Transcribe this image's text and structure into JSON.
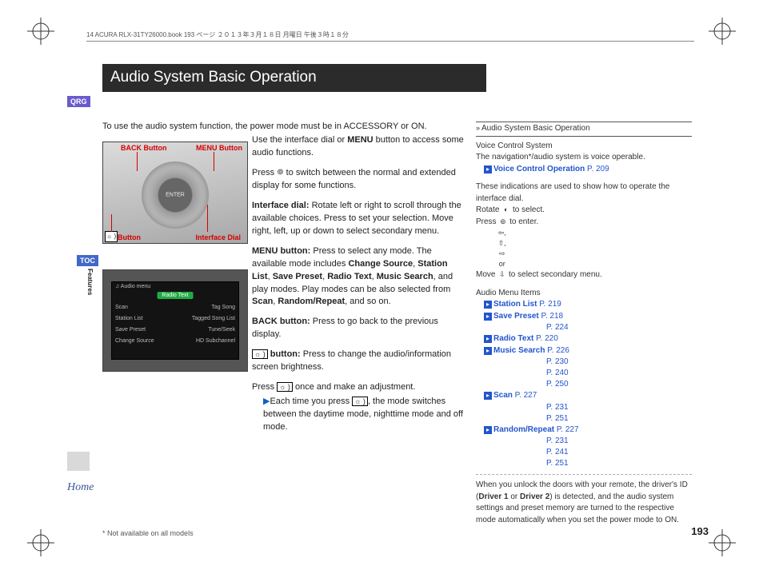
{
  "book_info": "14 ACURA RLX-31TY26000.book  193 ページ  ２０１３年３月１８日  月曜日  午後３時１８分",
  "title": "Audio System Basic Operation",
  "tabs": {
    "qrg": "QRG",
    "toc": "TOC",
    "features": "Features",
    "home": "Home"
  },
  "intro": "To use the audio system function, the power mode must be in ACCESSORY or ON.",
  "photo1_labels": {
    "back": "BACK Button",
    "menu": "MENU Button",
    "bright": "Button",
    "dial": "Interface Dial",
    "bright_icon": "☼ )",
    "enter": "ENTER"
  },
  "photo2": {
    "title": "♫ Audio menu",
    "center": "Radio Text",
    "rows_left": [
      "Scan",
      "Station List",
      "Save Preset",
      "Change Source"
    ],
    "rows_right": [
      "Tag Song",
      "Tagged Song List",
      "Tune/Seek",
      "HD Subchannel"
    ]
  },
  "main": {
    "p1a": "Use the interface dial or ",
    "p1b": "MENU",
    "p1c": " button to access some audio functions.",
    "p2a": "Press ",
    "p2_icon": "⊚",
    "p2b": " to switch between the normal and extended display for some functions.",
    "p3a": "Interface dial:",
    "p3b": " Rotate left or right to scroll through the available choices. Press to set your selection. Move right, left, up or down to select secondary menu.",
    "p4a": "MENU button:",
    "p4b": " Press to select any mode. The available mode includes ",
    "p4c": "Change Source",
    "p4d": ", ",
    "p4e": "Station List",
    "p4f": ", ",
    "p4g": "Save Preset",
    "p4h": ", ",
    "p4i": "Radio Text",
    "p4j": ", ",
    "p4k": "Music Search",
    "p4l": ", and play modes. Play modes can be also selected from ",
    "p4m": "Scan",
    "p4n": ", ",
    "p4o": "Random/Repeat",
    "p4p": ", and so on.",
    "p5a": "BACK button:",
    "p5b": " Press to go back to the previous display.",
    "p6_icon": "☼ )",
    "p6a": " button:",
    "p6b": " Press to change the audio/information screen brightness.",
    "p7a": "Press ",
    "p7_icon": "☼ )",
    "p7b": " once and make an adjustment.",
    "p8_mark": "▶",
    "p8a": "Each time you press ",
    "p8_icon": "☼ )",
    "p8b": ", the mode switches between the daytime mode, nighttime mode and off mode."
  },
  "side": {
    "header_mark": "»",
    "header": "Audio System Basic Operation",
    "voice1": "Voice Control System",
    "voice2": "The navigation*/audio system is voice operable.",
    "voice_link": "Voice Control Operation",
    "voice_pg": " P. 209",
    "indic": "These indications are used to show how to operate the interface dial.",
    "rotate": "Rotate ",
    "rotate_icon": "◐",
    "rotate2": " to select.",
    "press": "Press ",
    "press_icon": "⊚",
    "press2": " to enter.",
    "move": "Move ",
    "move_icons": "⇦, ⇧, ⇨ or ⇩",
    "move2": " to select secondary menu.",
    "menu_hdr": "Audio Menu Items",
    "items": [
      {
        "name": "Station List",
        "pg": " P. 219",
        "extra": []
      },
      {
        "name": "Save Preset",
        "pg": " P. 218",
        "extra": [
          "P. 224"
        ]
      },
      {
        "name": "Radio Text",
        "pg": " P. 220",
        "extra": []
      },
      {
        "name": "Music Search",
        "pg": " P. 226",
        "extra": [
          "P. 230",
          "P. 240",
          "P. 250"
        ]
      },
      {
        "name": "Scan",
        "pg": " P. 227",
        "extra": [
          "P. 231",
          "P. 251"
        ]
      },
      {
        "name": "Random/Repeat",
        "pg": " P. 227",
        "extra": [
          "P. 231",
          "P. 241",
          "P. 251"
        ]
      }
    ],
    "unlock": "When you unlock the doors with your remote, the driver's ID (",
    "unlock_b1": "Driver 1",
    "unlock_mid": " or ",
    "unlock_b2": "Driver 2",
    "unlock2": ") is detected, and the audio system settings and preset memory are turned to the respective mode automatically when you set the power mode to ON."
  },
  "footnote": "* Not available on all models",
  "pagenum": "193"
}
